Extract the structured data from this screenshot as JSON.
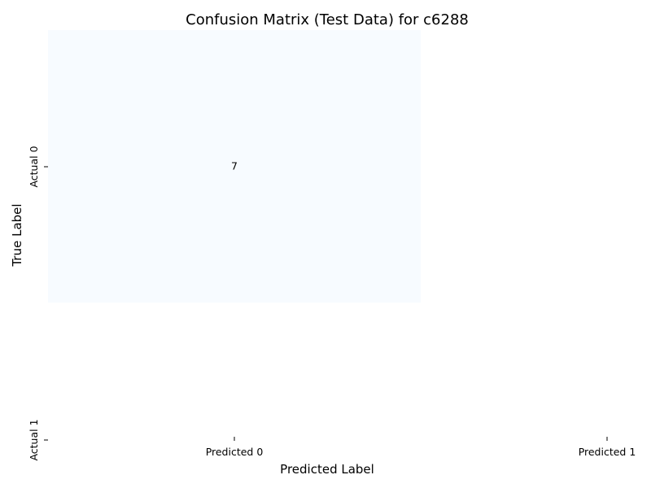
{
  "chart_data": {
    "type": "heatmap",
    "title": "Confusion Matrix (Test Data) for c6288",
    "xlabel": "Predicted Label",
    "ylabel": "True Label",
    "x_categories": [
      "Predicted 0",
      "Predicted 1"
    ],
    "y_categories": [
      "Actual 0",
      "Actual 1"
    ],
    "cells": [
      {
        "row": 0,
        "col": 0,
        "value": 7,
        "label": "7",
        "color": "#f7fbff"
      }
    ],
    "colorbar": false,
    "grid": false
  }
}
